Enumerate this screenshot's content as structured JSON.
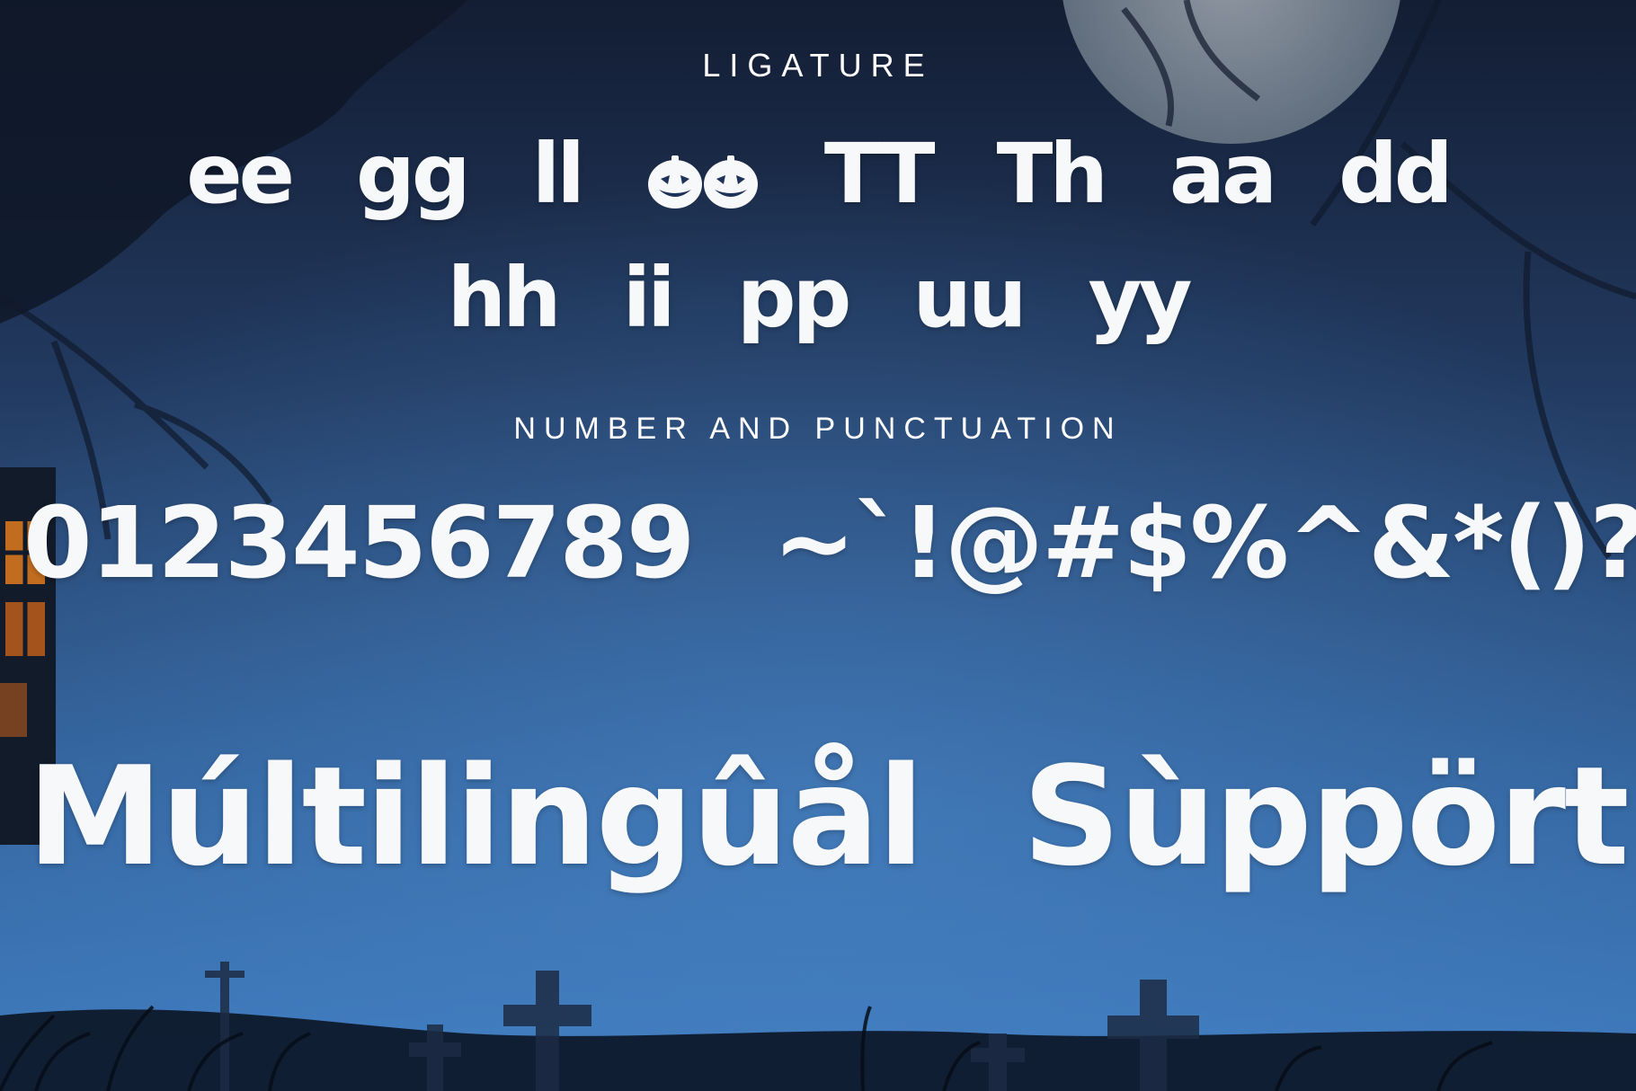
{
  "sections": {
    "ligature_label": "LIGATURE",
    "numbers_label": "NUMBER AND PUNCTUATION"
  },
  "ligatures": {
    "row1": [
      "ee",
      "gg",
      "ll",
      "TT",
      "Th",
      "aa",
      "dd"
    ],
    "row2": [
      "hh",
      "ii",
      "pp",
      "uu",
      "yy"
    ]
  },
  "digits": "0123456789",
  "punctuation": "~`!@#$%^&*()?",
  "showcase": {
    "word1": "Múltilingûål",
    "word2": "Sùppört"
  },
  "colors": {
    "text": "#f7f8fa",
    "sky_top": "#16223a",
    "sky_mid": "#2e5688",
    "sky_bottom": "#3f7cc0",
    "moon": "#8f9aa6",
    "ground": "#0b1424",
    "window_glow": "#e07a1c"
  },
  "icons": [
    "pumpkin-icon",
    "moon-icon",
    "tree-branch-icon",
    "house-icon",
    "tombstone-cross-icon"
  ]
}
